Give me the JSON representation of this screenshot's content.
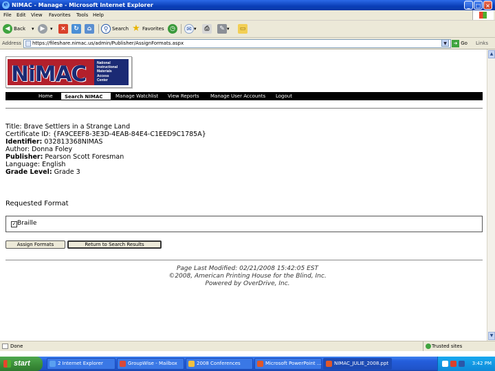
{
  "window": {
    "title": "NIMAC - Manage - Microsoft Internet Explorer",
    "minimize": "_",
    "maximize": "□",
    "close": "×"
  },
  "menu": [
    "File",
    "Edit",
    "View",
    "Favorites",
    "Tools",
    "Help"
  ],
  "toolbar": {
    "back": "Back",
    "search": "Search",
    "favorites": "Favorites"
  },
  "address": {
    "label": "Address",
    "url": "https://fileshare.nimac.us/admin/Publisher/AssignFormats.aspx",
    "go": "Go",
    "links": "Links"
  },
  "logo": {
    "word": "NiMAC",
    "lines": [
      "National",
      "Instructional",
      "Materials",
      "Access",
      "Center"
    ]
  },
  "nav": [
    {
      "label": "Home",
      "active": false
    },
    {
      "label": "Search NIMAC",
      "active": true
    },
    {
      "label": "Manage Watchlist",
      "active": false
    },
    {
      "label": "View Reports",
      "active": false
    },
    {
      "label": "Manage User Accounts",
      "active": false
    },
    {
      "label": "Logout",
      "active": false
    }
  ],
  "book": {
    "title_label": "Title:",
    "title": "Brave Settlers in a Strange Land",
    "cert_label": "Certificate ID:",
    "cert": "{FA9CEEF8-3E3D-4EAB-84E4-C1EED9C1785A}",
    "ident_label": "Identifier:",
    "ident": "032813368NIMAS",
    "author_label": "Author:",
    "author": "Donna Foley",
    "publisher_label": "Publisher:",
    "publisher": "Pearson Scott Foresman",
    "language_label": "Language:",
    "language": "English",
    "grade_label": "Grade Level:",
    "grade": "Grade 3"
  },
  "requested": {
    "heading": "Requested Format",
    "format": "Braille",
    "checked": true
  },
  "buttons": {
    "assign": "Assign Formats",
    "return": "Return to Search Results"
  },
  "footer": [
    "Page Last Modified: 02/21/2008 15:42:05 EST",
    "©2008, American Printing House for the Blind, Inc.",
    "Powered by OverDrive, Inc."
  ],
  "status": {
    "text": "Done",
    "zone": "Trusted sites"
  },
  "taskbar": {
    "start": "start",
    "tasks": [
      {
        "label": "2 Internet Explorer",
        "active": false,
        "color": "#5aa0f0"
      },
      {
        "label": "GroupWise - Mailbox",
        "active": false,
        "color": "#d94a3a"
      },
      {
        "label": "2008 Conferences",
        "active": false,
        "color": "#f0c040"
      },
      {
        "label": "Microsoft PowerPoint ...",
        "active": false,
        "color": "#e0582a"
      },
      {
        "label": "NIMAC_JULIE_2008.ppt",
        "active": true,
        "color": "#e0582a"
      }
    ],
    "clock": "3:42 PM"
  }
}
